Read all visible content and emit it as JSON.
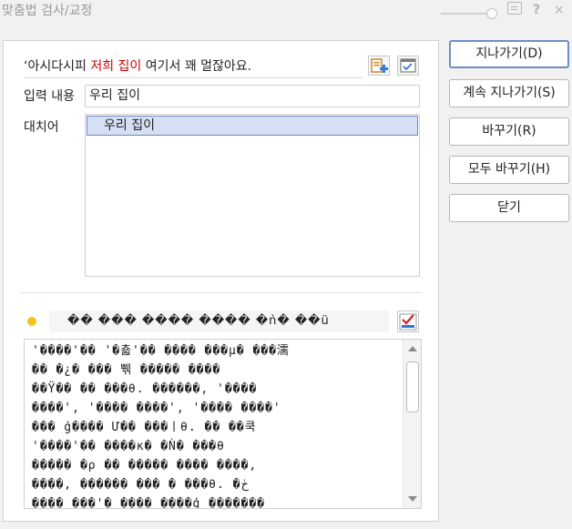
{
  "window": {
    "title": "맞춤법 검사/교정",
    "controls": {
      "slider": "opacity-slider",
      "memo": "memo-icon",
      "help": "?",
      "close": "×"
    }
  },
  "checked_sentence": {
    "prefix": "‘아시다시피 ",
    "highlighted": "저희 집이",
    "suffix": " 여기서 꽤 멀잖아요."
  },
  "icons": {
    "insert_dictionary": "dictionary-add-icon",
    "check_option": "check-option-icon",
    "spellcheck": "spellcheck-icon"
  },
  "input": {
    "label": "입력 내용",
    "value": "우리 집이"
  },
  "replacement": {
    "label": "대치어",
    "items": [
      "우리 집이"
    ]
  },
  "help": {
    "line": "�� ��� ���� ���� �ǹ� ��ü",
    "text": [
      "'����'�� '�춃'�� ���� ���µ� ���濡",
      "�� �¿� ��� 쀆 ����� ����",
      "��Ÿ�� �� ���θ. ������, '����",
      "����', '���� ����', '���� ����'",
      "��� ģ���� Ư�� ���ㅣθ. �� ��쿡",
      "'����'�� ����ĸ� �Ǹ� ���θ",
      "����� �ρ  �� ����� ���� ����,",
      "����, ������ ���  � ���θ. �ڂ",
      "���� ���'� ���� ����ģ �������"
    ]
  },
  "buttons": {
    "skip": "지나가기(D)",
    "skip_all": "계속 지나가기(S)",
    "replace": "바꾸기(R)",
    "replace_all": "모두 바꾸기(H)",
    "close": "닫기"
  }
}
